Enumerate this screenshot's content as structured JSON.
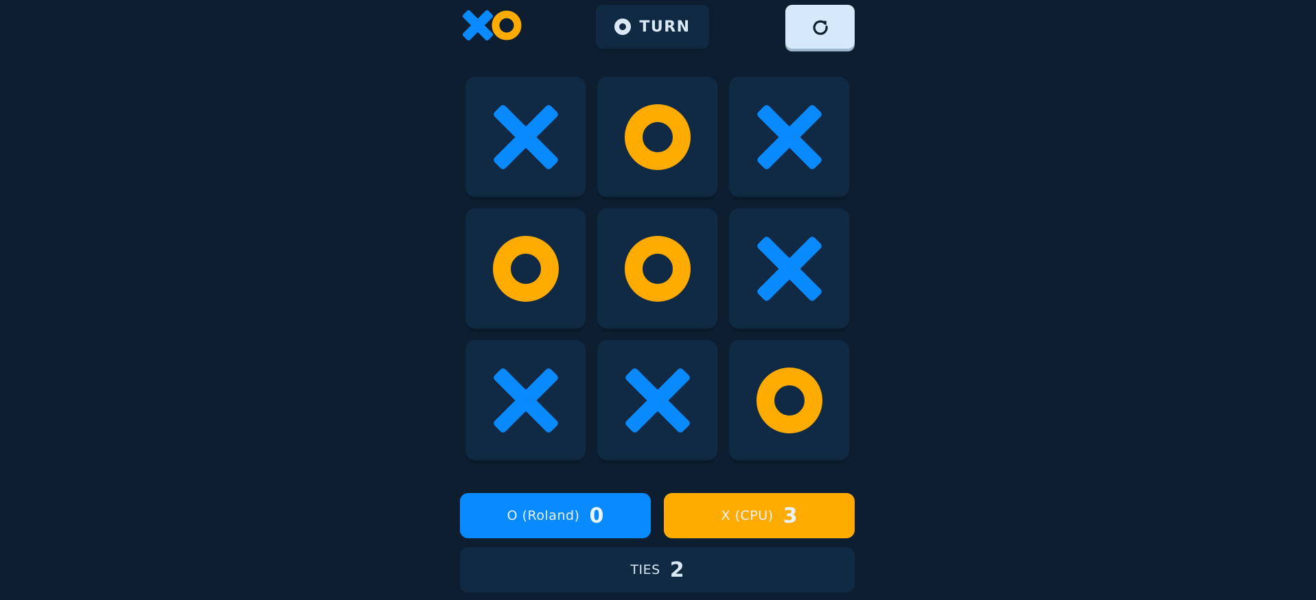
{
  "colors": {
    "background": "#0c1e2f",
    "cell": "#0f2a42",
    "x_mark": "#0a8aff",
    "o_mark": "#ffab00",
    "restart_button": "#d6e9fb"
  },
  "header": {
    "logo_icons": [
      "x-icon",
      "o-icon"
    ],
    "turn": {
      "mark": "O",
      "label": "TURN"
    },
    "restart_icon": "restart-icon"
  },
  "board": {
    "cells": [
      "X",
      "O",
      "X",
      "O",
      "O",
      "X",
      "X",
      "X",
      "O"
    ]
  },
  "scores": {
    "o": {
      "label": "O (Roland)",
      "value": "0"
    },
    "x": {
      "label": "X (CPU)",
      "value": "3"
    },
    "ties": {
      "label": "TIES",
      "value": "2"
    }
  }
}
